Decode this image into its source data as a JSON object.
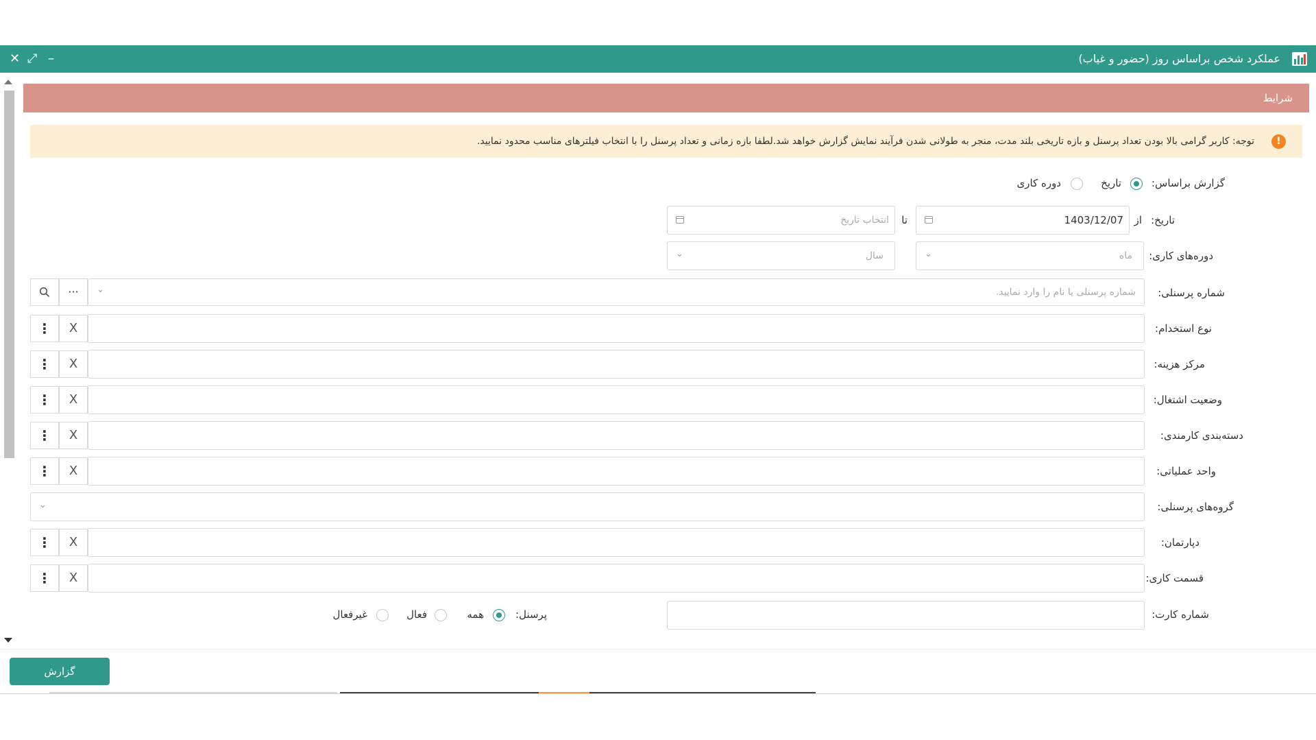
{
  "window": {
    "title": "عملکرد شخص براساس روز (حضور و غیاب)",
    "controls": {
      "close": "✕",
      "maximize": "⤢",
      "minimize": "–"
    }
  },
  "section": {
    "title": "شرایط"
  },
  "notice": {
    "icon": "!",
    "text": "توجه: کاربر گرامی بالا بودن تعداد پرسنل و بازه تاریخی بلند مدت، منجر به طولانی شدن فرآیند نمایش گزارش خواهد شد.لطفا بازه زمانی و تعداد پرسنل را با انتخاب فیلترهای مناسب محدود نمایید."
  },
  "form": {
    "report_basis": {
      "label": "گزارش براساس:",
      "options": [
        "تاریخ",
        "دوره کاری"
      ],
      "selected": "تاریخ"
    },
    "date": {
      "label": "تاریخ:",
      "from_label": "از",
      "from_value": "1403/12/07",
      "to_label": "تا",
      "to_placeholder": "انتخاب تاریخ"
    },
    "periods": {
      "label": "دوره‌های کاری:",
      "month_placeholder": "ماه",
      "year_placeholder": "سال"
    },
    "personnel_number": {
      "label": "شماره پرسنلی:",
      "placeholder": "شماره پرسنلی یا نام را وارد نمایید.",
      "more": "···"
    },
    "employment_type": {
      "label": "نوع استخدام:"
    },
    "cost_center": {
      "label": "مرکز هزینه:"
    },
    "job_status": {
      "label": "وضعیت اشتغال:"
    },
    "employee_category": {
      "label": "دسته‌بندی کارمندی:"
    },
    "operating_unit": {
      "label": "واحد عملیاتی:"
    },
    "personnel_groups": {
      "label": "گروه‌های پرسنلی:"
    },
    "department": {
      "label": "دپارتمان:"
    },
    "work_section": {
      "label": "قسمت کاری:"
    },
    "card_number": {
      "label": "شماره کارت:"
    },
    "personnel_filter": {
      "label": "پرسنل:",
      "options": [
        "همه",
        "فعال",
        "غیرفعال"
      ],
      "selected": "همه"
    }
  },
  "actions": {
    "report": "گزارش"
  },
  "icons": {
    "remove": "X",
    "kebab": "⋮",
    "chevron": "⌄"
  },
  "colors": {
    "title_bar": "#2f9a8c",
    "section_header": "#d8948a",
    "notice_bg": "#fcefd5",
    "warning": "#f5841f"
  }
}
